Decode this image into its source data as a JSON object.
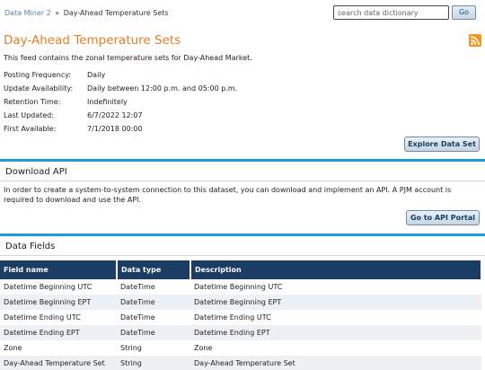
{
  "breadcrumb": {
    "root": "Data Miner 2",
    "separator": "»",
    "current": "Day-Ahead Temperature Sets"
  },
  "search": {
    "placeholder": "search data dictionary",
    "go_label": "Go"
  },
  "page": {
    "title": "Day-Ahead Temperature Sets",
    "description": "This feed contains the zonal temperature sets for Day-Ahead Market."
  },
  "meta": [
    {
      "label": "Posting Frequency:",
      "value": "Daily"
    },
    {
      "label": "Update Availability:",
      "value": "Daily between 12:00 p.m. and 05:00 p.m."
    },
    {
      "label": "Retention Time:",
      "value": "Indefinitely"
    },
    {
      "label": "Last Updated:",
      "value": "6/7/2022 12:07"
    },
    {
      "label": "First Available:",
      "value": "7/1/2018 00:00"
    }
  ],
  "explore_button": "Explore Data Set",
  "download_api": {
    "heading": "Download API",
    "text": "In order to create a system-to-system connection to this dataset, you can download and implement an API. A PJM account is required to download and use the API.",
    "button": "Go to API Portal"
  },
  "data_fields": {
    "heading": "Data Fields",
    "columns": [
      "Field name",
      "Data type",
      "Description"
    ],
    "rows": [
      [
        "Datetime Beginning UTC",
        "DateTime",
        "Datetime Beginning UTC"
      ],
      [
        "Datetime Beginning EPT",
        "DateTime",
        "Datetime Beginning EPT"
      ],
      [
        "Datetime Ending UTC",
        "DateTime",
        "Datetime Ending UTC"
      ],
      [
        "Datetime Ending EPT",
        "DateTime",
        "Datetime Ending EPT"
      ],
      [
        "Zone",
        "String",
        "Zone"
      ],
      [
        "Day-Ahead Temperature Set",
        "String",
        "Day-Ahead Temperature Set"
      ]
    ]
  },
  "colors": {
    "title": "#e67e22",
    "section_bar": "#1e9ed8",
    "table_header": "#1b3c63",
    "rss": "#f7941d"
  },
  "icons": {
    "feed": "rss-icon"
  }
}
